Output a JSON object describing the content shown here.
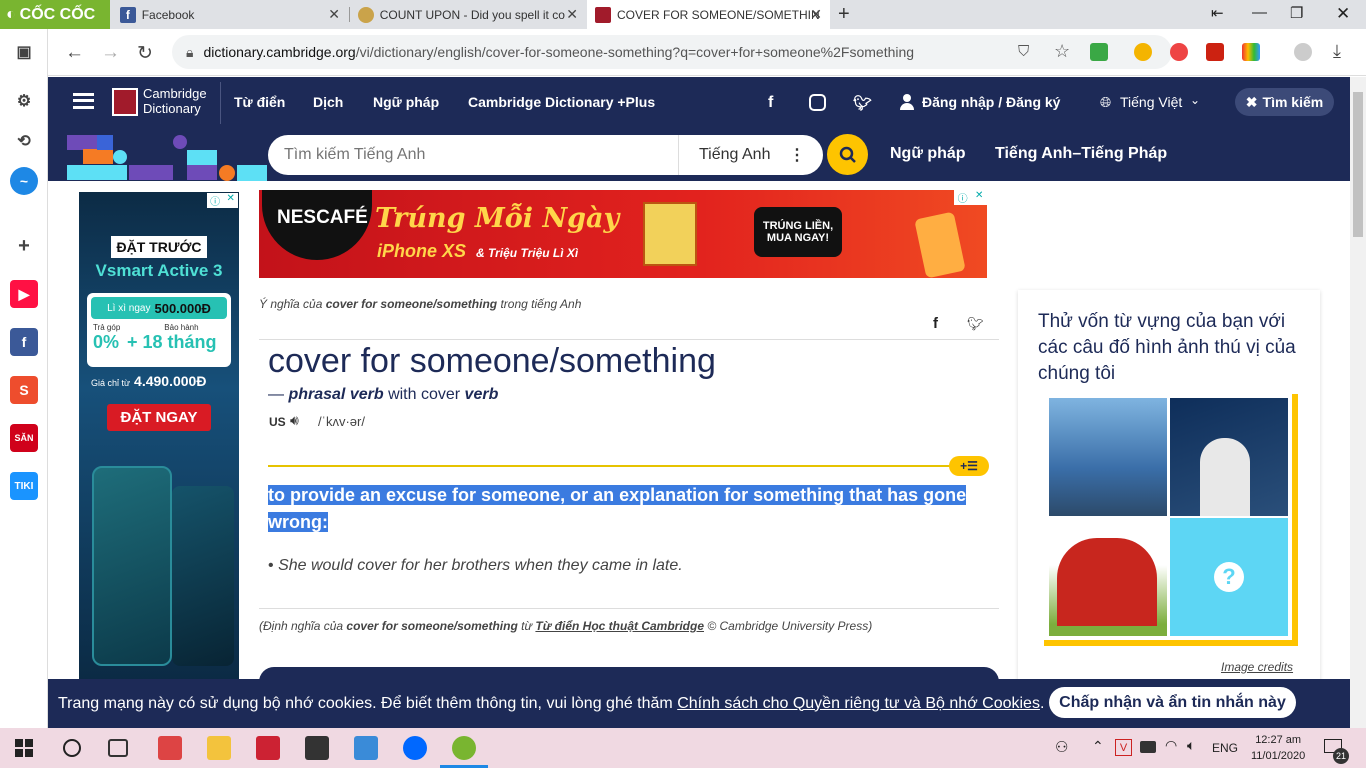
{
  "browser": {
    "brand": "CỐC CỐC",
    "tabs": [
      {
        "title": "Facebook"
      },
      {
        "title": "COUNT UPON - Did you spell it co"
      },
      {
        "title": "COVER FOR SOMEONE/SOMETHIN"
      }
    ],
    "url_host": "dictionary.cambridge.org",
    "url_path": "/vi/dictionary/english/cover-for-someone-something?q=cover+for+someone%2Fsomething"
  },
  "site": {
    "logo_line1": "Cambridge",
    "logo_line2": "Dictionary",
    "nav": [
      "Từ điển",
      "Dịch",
      "Ngữ pháp",
      "Cambridge Dictionary +Plus"
    ],
    "login": "Đăng nhập / Đăng ký",
    "language": "Tiếng Việt",
    "search_toggle": "Tìm kiếm",
    "search_placeholder": "Tìm kiếm Tiếng Anh",
    "search_lang": "Tiếng Anh",
    "nav2": [
      "Ngữ pháp",
      "Tiếng Anh–Tiếng Pháp"
    ]
  },
  "ads": {
    "left": {
      "cta_top": "ĐẶT TRƯỚC",
      "product": "Vsmart Active 3",
      "lixi_label": "Lì xì ngay",
      "lixi_value": "500.000Đ",
      "installment_label": "Trả góp",
      "installment_value": "0%",
      "warranty_label": "Bảo hành",
      "warranty_value": "+ 18 tháng",
      "price_label": "Giá chỉ từ",
      "price_value": "4.490.000Đ",
      "cta_bottom": "ĐẶT NGAY"
    },
    "top": {
      "brand": "NESCAFÉ",
      "headline": "Trúng Mỗi Ngày",
      "sub": "iPhone XS",
      "sub2": "& Triệu Triệu Lì Xì",
      "badge": "TRÚNG LIỀN, MUA NGAY!"
    }
  },
  "entry": {
    "meaning_prefix": "Ý nghĩa của",
    "meaning_term": "cover for someone/something",
    "meaning_suffix": "trong tiếng Anh",
    "headword": "cover for someone/something",
    "pos_dash": "—",
    "pos": "phrasal verb",
    "pos_with": "with cover",
    "pos_verb": "verb",
    "region": "US",
    "pron": "/ˈkʌv·ər/",
    "definition": "to provide an excuse for someone, or an explanation for something that has gone wrong:",
    "example_bullet": "•",
    "example": "She would cover for her brothers when they came in late.",
    "source_prefix": "(Định nghĩa của",
    "source_term": "cover for someone/something",
    "source_from": "từ",
    "source_link": "Từ điển Học thuật Cambridge",
    "source_suffix": "© Cambridge University Press)"
  },
  "sidebar_quiz": {
    "title": "Thử vốn từ vựng của bạn với các câu đố hình ảnh thú vị của chúng tôi",
    "credits": "Image credits"
  },
  "cookie": {
    "text": "Trang mạng này có sử dụng bộ nhớ cookies. Để biết thêm thông tin, vui lòng ghé thăm",
    "link": "Chính sách cho Quyền riêng tư và Bộ nhớ Cookies",
    "end": ".",
    "button": "Chấp nhận và ẩn tin nhắn này"
  },
  "taskbar": {
    "time": "12:27 am",
    "date": "11/01/2020",
    "lang": "ENG",
    "notif": "21"
  },
  "colors": {
    "navy": "#1d2a57",
    "accent": "#fec400",
    "selection": "#3b7be0"
  }
}
